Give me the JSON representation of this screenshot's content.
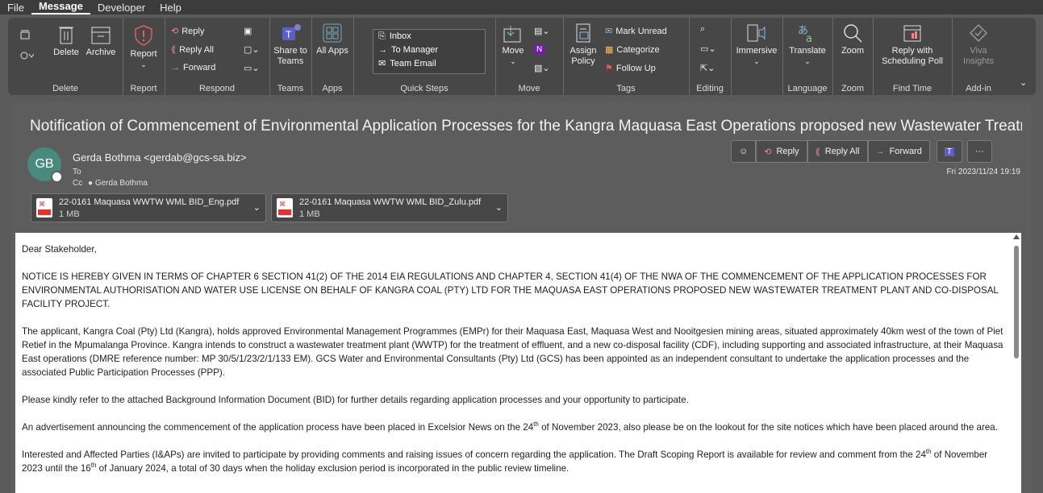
{
  "menu": [
    "File",
    "Message",
    "Developer",
    "Help"
  ],
  "ribbon": {
    "delete_group": {
      "delete": "Delete",
      "archive": "Archive",
      "label": "Delete"
    },
    "report_group": {
      "report": "Report",
      "label": "Report"
    },
    "respond_group": {
      "reply": "Reply",
      "reply_all": "Reply All",
      "forward": "Forward",
      "label": "Respond"
    },
    "teams_group": {
      "share": "Share to Teams",
      "label": "Teams"
    },
    "apps_group": {
      "all_apps": "All Apps",
      "label": "Apps"
    },
    "quick_steps": {
      "items": [
        "Inbox",
        "To Manager",
        "Team Email"
      ],
      "label": "Quick Steps"
    },
    "move_group": {
      "move": "Move",
      "label": "Move"
    },
    "tags_group": {
      "assign_policy": "Assign Policy",
      "mark_unread": "Mark Unread",
      "categorize": "Categorize",
      "follow_up": "Follow Up",
      "label": "Tags"
    },
    "editing_group": {
      "label": "Editing"
    },
    "immersive": {
      "label": "Immersive"
    },
    "language_group": {
      "translate": "Translate",
      "label": "Language"
    },
    "zoom_group": {
      "zoom": "Zoom",
      "label": "Zoom"
    },
    "find_time_group": {
      "reply_poll": "Reply with Scheduling Poll",
      "label": "Find Time"
    },
    "addin_group": {
      "viva": "Viva Insights",
      "label": "Add-in"
    }
  },
  "email": {
    "subject": "Notification of Commencement of Environmental Application Processes for the Kangra Maquasa East Operations proposed new Wastewater Treatment P...",
    "avatar_initials": "GB",
    "sender": "Gerda Bothma <gerdab@gcs-sa.biz>",
    "to_label": "To",
    "cc_label": "Cc",
    "cc_name": "Gerda Bothma",
    "date": "Fri 2023/11/24 19:19",
    "actions": {
      "reply": "Reply",
      "reply_all": "Reply All",
      "forward": "Forward"
    },
    "attachments": [
      {
        "name": "22-0161 Maquasa WWTW  WML BID_Eng.pdf",
        "size": "1 MB"
      },
      {
        "name": "22-0161 Maquasa WWTW  WML BID_Zulu.pdf",
        "size": "1 MB"
      }
    ],
    "body": {
      "greeting": "Dear Stakeholder,",
      "notice": "NOTICE IS HEREBY GIVEN IN TERMS OF CHAPTER 6 SECTION 41(2) OF THE 2014 EIA REGULATIONS AND CHAPTER 4, SECTION 41(4) OF THE NWA OF THE COMMENCEMENT OF THE APPLICATION PROCESSES FOR ENVIRONMENTAL AUTHORISATION AND WATER USE LICENSE ON BEHALF OF KANGRA COAL (PTY) LTD FOR THE MAQUASA EAST OPERATIONS PROPOSED NEW WASTEWATER TREATMENT PLANT AND CO-DISPOSAL FACILITY PROJECT.",
      "applicant": "The applicant, Kangra Coal (Pty) Ltd (Kangra), holds approved Environmental Management Programmes (EMPr) for their Maquasa East, Maquasa West and Nooitgesien mining areas, situated approximately 40km west of the town of Piet Retief in the Mpumalanga Province.  Kangra intends to construct a wastewater treatment plant (WWTP) for the treatment of effluent, and a new co-disposal facility (CDF), including supporting and associated infrastructure, at their Maquasa East operations (DMRE reference number: MP 30/5/1/23/2/1/133 EM). GCS Water and Environmental Consultants (Pty) Ltd (GCS) has been appointed as an independent consultant to undertake the application  processes and the associated Public Participation Processes (PPP).",
      "refer": "Please kindly refer to the attached Background Information Document (BID) for further details regarding application processes and your opportunity to participate.",
      "advert_a": "An advertisement announcing the commencement of the application process have been placed in Excelsior News on the 24",
      "advert_sup": "th",
      "advert_b": " of November 2023, also please be on the lookout for the site notices which have been placed around the area.",
      "iap_a": "Interested and Affected Parties (I&APs) are invited to participate by providing comments and raising issues of concern regarding the application. The Draft Scoping Report is available for review and comment from the 24",
      "iap_sup1": "th",
      "iap_b": " of November 2023 until the 16",
      "iap_sup2": "th",
      "iap_c": " of January 2024, a total of 30 days when the holiday exclusion period is incorporated in the public review timeline."
    }
  }
}
